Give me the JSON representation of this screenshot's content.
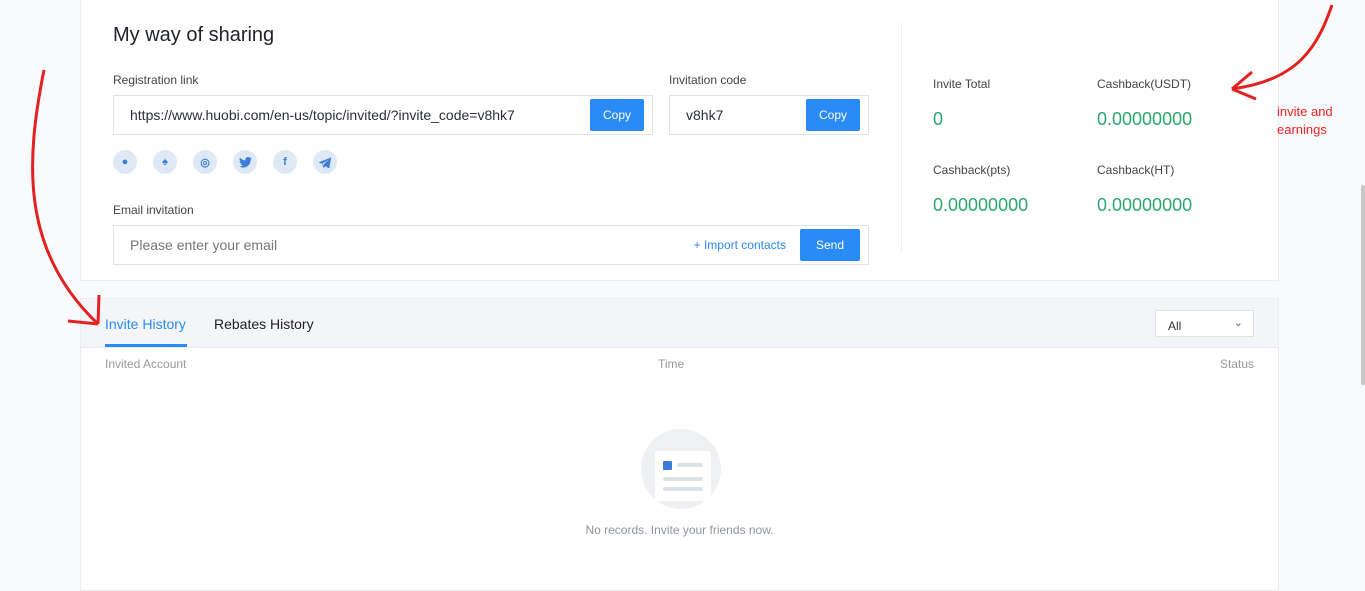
{
  "sharing": {
    "title": "My way of sharing",
    "registration_label": "Registration link",
    "registration_link": "https://www.huobi.com/en-us/topic/invited/?invite_code=v8hk7",
    "copy_label": "Copy",
    "invitation_label": "Invitation code",
    "invitation_code": "v8hk7",
    "email_label": "Email invitation",
    "email_placeholder": "Please enter your email",
    "import_contacts": "+ Import contacts",
    "send_label": "Send",
    "social_icons": [
      "wechat-icon",
      "qq-icon",
      "weibo-icon",
      "twitter-icon",
      "facebook-icon",
      "telegram-icon"
    ]
  },
  "stats": {
    "invite_total_label": "Invite Total",
    "invite_total": "0",
    "cashback_usdt_label": "Cashback(USDT)",
    "cashback_usdt": "0.00000000",
    "cashback_pts_label": "Cashback(pts)",
    "cashback_pts": "0.00000000",
    "cashback_ht_label": "Cashback(HT)",
    "cashback_ht": "0.00000000"
  },
  "history": {
    "tabs": [
      "Invite History",
      "Rebates History"
    ],
    "filter_value": "All",
    "columns": [
      "Invited Account",
      "Time",
      "Status"
    ],
    "empty_text": "No records. Invite your friends now."
  },
  "annotation": {
    "line1": "invite and",
    "line2": "earnings"
  },
  "colors": {
    "accent": "#2a8af6",
    "positive": "#2aa86d",
    "annotation": "#e22222"
  }
}
